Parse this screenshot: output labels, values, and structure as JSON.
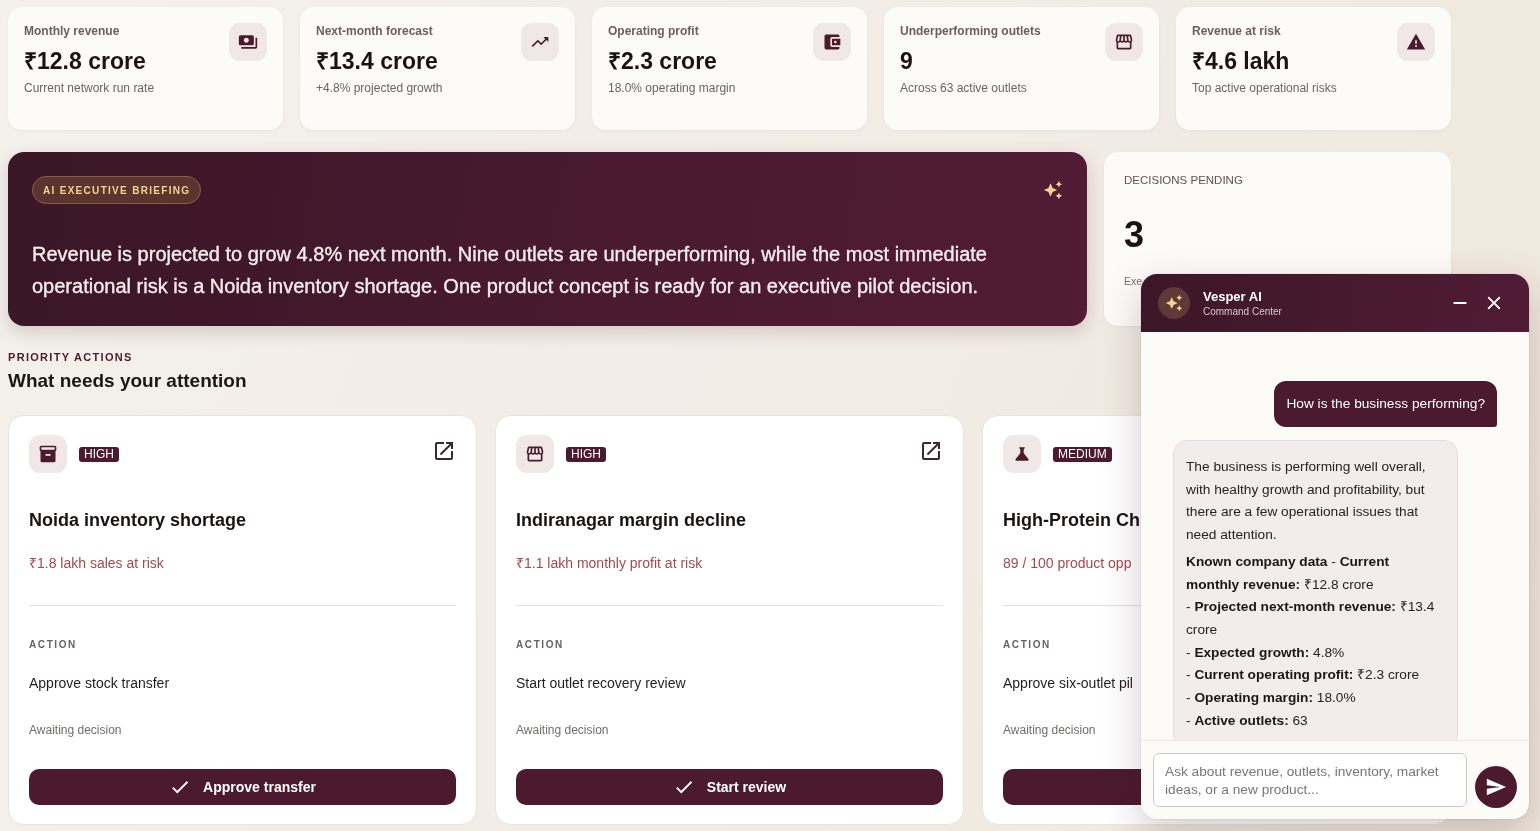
{
  "kpis": [
    {
      "label": "Monthly revenue",
      "value": "₹12.8 crore",
      "note": "Current network run rate"
    },
    {
      "label": "Next-month forecast",
      "value": "₹13.4 crore",
      "note": "+4.8% projected growth"
    },
    {
      "label": "Operating profit",
      "value": "₹2.3 crore",
      "note": "18.0% operating margin"
    },
    {
      "label": "Underperforming outlets",
      "value": "9",
      "note": "Across 63 active outlets"
    },
    {
      "label": "Revenue at risk",
      "value": "₹4.6 lakh",
      "note": "Top active operational risks"
    }
  ],
  "briefing": {
    "badge": "AI EXECUTIVE BRIEFING",
    "text": "Revenue is projected to grow 4.8% next month. Nine outlets are underperforming, while the most immediate operational risk is a Noida inventory shortage. One product concept is ready for an executive pilot decision."
  },
  "decisions": {
    "label": "DECISIONS PENDING",
    "value": "3",
    "note": "Exe"
  },
  "priority": {
    "eyebrow": "PRIORITY ACTIONS",
    "title": "What needs your attention",
    "cards": [
      {
        "badge": "HIGH",
        "title": "Noida inventory shortage",
        "impact": "₹1.8 lakh sales at risk",
        "action_label": "ACTION",
        "action": "Approve stock transfer",
        "status": "Awaiting decision",
        "button": "Approve transfer",
        "open_link": true
      },
      {
        "badge": "HIGH",
        "title": "Indiranagar margin decline",
        "impact": "₹1.1 lakh monthly profit at risk",
        "action_label": "ACTION",
        "action": "Start outlet recovery review",
        "status": "Awaiting decision",
        "button": "Start review",
        "open_link": true
      },
      {
        "badge": "MEDIUM",
        "title": "High-Protein Ch",
        "impact": "89 / 100 product opp",
        "action_label": "ACTION",
        "action": "Approve six-outlet pil",
        "status": "Awaiting decision"
      }
    ]
  },
  "chat": {
    "title": "Vesper AI",
    "subtitle": "Command Center",
    "messages": [
      {
        "kind": "user",
        "text": "How is the business performing?"
      },
      {
        "kind": "assistant",
        "paragraphs": [
          "The business is performing well overall, with healthy growth and profitability, but there are a few operational issues that need attention.",
          "**Known company data** - **Current monthly revenue:** ₹12.8 crore",
          "- **Projected next-month revenue:** ₹13.4 crore",
          "- **Expected growth:** 4.8%",
          "- **Current operating profit:** ₹2.3 crore",
          "- **Operating margin:** 18.0%",
          "- **Active outlets:** 63"
        ]
      }
    ],
    "input": {
      "placeholder": "Ask about revenue, outlets, inventory, market ideas, or a new product..."
    }
  }
}
